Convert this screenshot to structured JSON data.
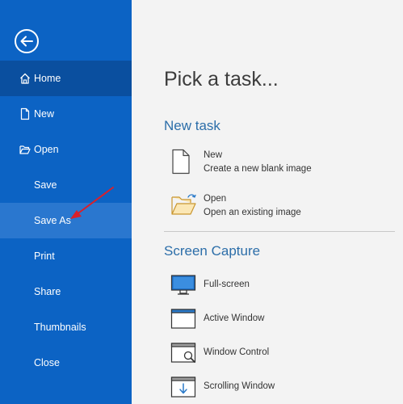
{
  "sidebar": {
    "items": [
      {
        "label": "Home"
      },
      {
        "label": "New"
      },
      {
        "label": "Open"
      },
      {
        "label": "Save"
      },
      {
        "label": "Save As"
      },
      {
        "label": "Print"
      },
      {
        "label": "Share"
      },
      {
        "label": "Thumbnails"
      },
      {
        "label": "Close"
      }
    ]
  },
  "main": {
    "title": "Pick a task...",
    "new_task": {
      "heading": "New task",
      "tasks": [
        {
          "name": "New",
          "description": "Create a new blank image",
          "icon": "blank-page-icon"
        },
        {
          "name": "Open",
          "description": "Open an existing image",
          "icon": "open-folder-icon"
        }
      ]
    },
    "screen_capture": {
      "heading": "Screen Capture",
      "modes": [
        {
          "label": "Full-screen",
          "icon": "monitor-icon"
        },
        {
          "label": "Active Window",
          "icon": "window-icon"
        },
        {
          "label": "Window Control",
          "icon": "window-magnifier-icon"
        },
        {
          "label": "Scrolling Window",
          "icon": "scroll-window-icon"
        }
      ]
    }
  },
  "colors": {
    "sidebar": "#0c63c4",
    "sidebar_active": "#0a4f9f",
    "accent_text": "#2c6ea9",
    "annotation_arrow": "#d9202b"
  }
}
